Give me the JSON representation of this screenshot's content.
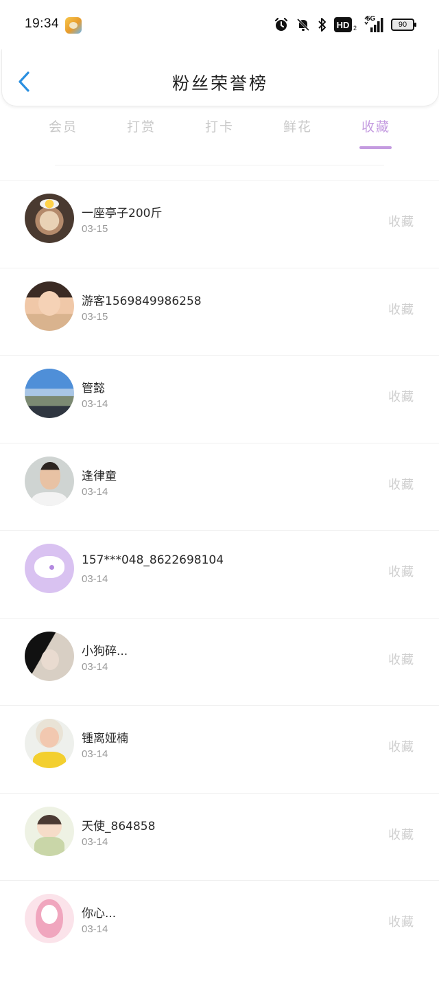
{
  "status_bar": {
    "time": "19:34",
    "hd_label": "HD",
    "hd_sub": "2",
    "network_label": "5G",
    "battery": "90"
  },
  "header": {
    "title": "粉丝荣誉榜"
  },
  "tabs": [
    {
      "label": "会员",
      "active": false
    },
    {
      "label": "打赏",
      "active": false
    },
    {
      "label": "打卡",
      "active": false
    },
    {
      "label": "鲜花",
      "active": false
    },
    {
      "label": "收藏",
      "active": true
    }
  ],
  "colors": {
    "accent": "#c49be0",
    "back_arrow": "#2a8fe0",
    "inactive_tab": "#c8c8c8",
    "action_text": "#cfcfcf"
  },
  "fans": [
    {
      "name": "一座亭子200斤",
      "date": "03-15",
      "action": "收藏",
      "avatar": "cake-photo"
    },
    {
      "name": "游客1569849986258",
      "date": "03-15",
      "action": "收藏",
      "avatar": "girl-photo"
    },
    {
      "name": "管懿",
      "date": "03-14",
      "action": "收藏",
      "avatar": "sky-landscape-photo"
    },
    {
      "name": "逢律童",
      "date": "03-14",
      "action": "收藏",
      "avatar": "boy-photo"
    },
    {
      "name": "157***048_8622698104",
      "date": "03-14",
      "action": "收藏",
      "avatar": "chat-bubble-default"
    },
    {
      "name": "小狗碎...",
      "date": "03-14",
      "action": "收藏",
      "avatar": "dark-portrait-photo"
    },
    {
      "name": "锺离娅楠",
      "date": "03-14",
      "action": "收藏",
      "avatar": "flower-girl-photo"
    },
    {
      "name": "天使_864858",
      "date": "03-14",
      "action": "收藏",
      "avatar": "cartoon-girl"
    },
    {
      "name": "你心...",
      "date": "03-14",
      "action": "收藏",
      "avatar": "pink-cartoon"
    }
  ]
}
